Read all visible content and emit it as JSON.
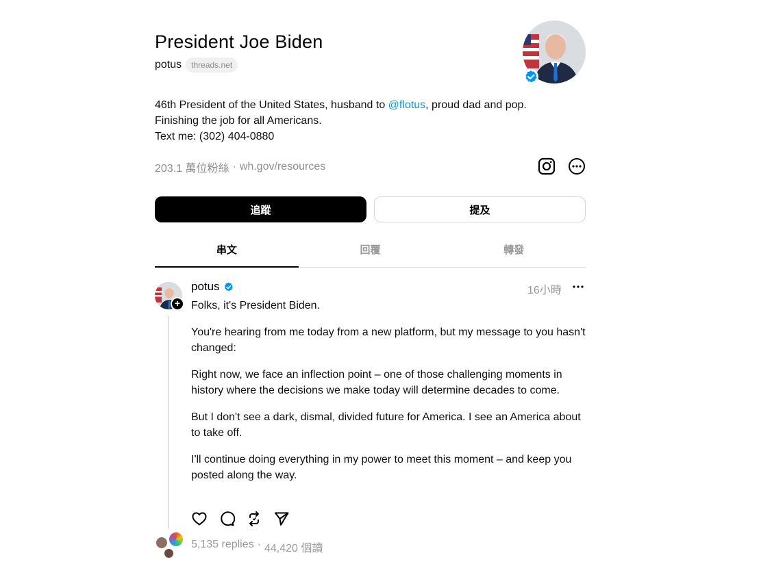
{
  "profile": {
    "name": "President Joe Biden",
    "handle": "potus",
    "domain_chip": "threads.net",
    "bio_line1_a": "46th President of the United States, husband to ",
    "bio_link": "@flotus",
    "bio_line1_b": ", proud dad and pop.",
    "bio_line2": "Finishing the job for all Americans.",
    "bio_line3": "Text me: (302) 404-0880",
    "followers": "203.1 萬位粉絲",
    "meta_sep": "·",
    "website": "wh.gov/resources"
  },
  "buttons": {
    "follow": "追蹤",
    "mention": "提及"
  },
  "tabs": [
    {
      "label": "串文"
    },
    {
      "label": "回覆"
    },
    {
      "label": "轉發"
    }
  ],
  "post": {
    "username": "potus",
    "time": "16小時",
    "paragraphs": [
      "Folks, it's President Biden.",
      "You're hearing from me today from a new platform, but my message to you hasn't changed:",
      "Right now, we face an inflection point – one of those challenging moments in history where the decisions we make today will determine decades to come.",
      "But I don't see a dark, dismal, divided future for America. I see an America about to take off.",
      "I'll continue doing everything in my power to meet this moment – and keep you posted along the way."
    ],
    "replies": "5,135 replies",
    "stats_sep": "·",
    "views": "44,420 個讀"
  },
  "icons": {
    "verified": "verified-badge-icon",
    "instagram": "instagram-icon",
    "more": "more-circle-icon",
    "like": "heart-icon",
    "reply": "comment-icon",
    "repost": "repost-icon",
    "share": "send-icon"
  },
  "colors": {
    "link": "#0a95d8",
    "verified": "#0095f6",
    "primary_button": "#000000",
    "muted_text": "#999999"
  }
}
